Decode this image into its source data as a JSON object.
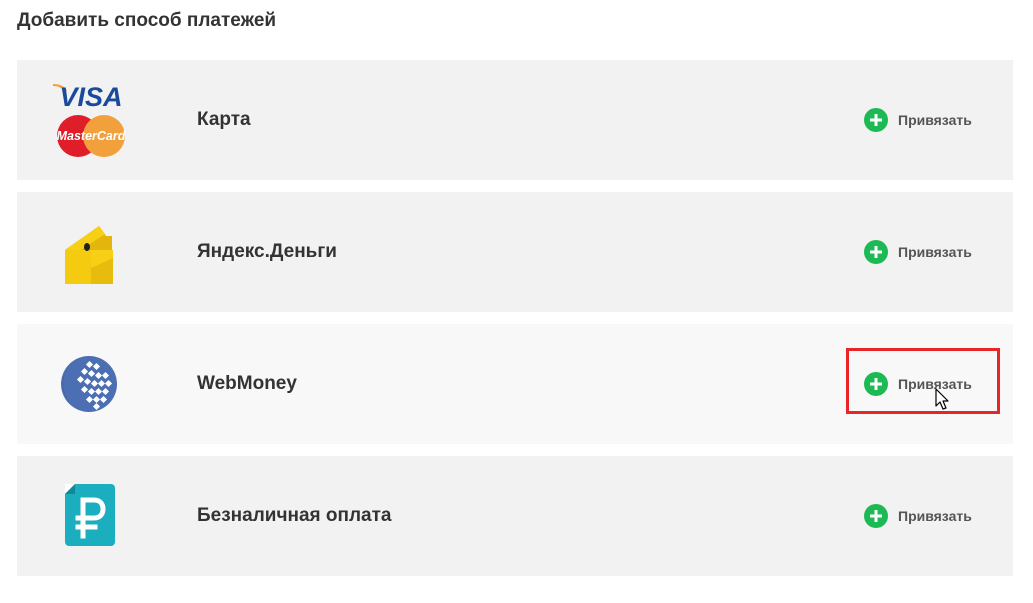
{
  "page": {
    "title": "Добавить способ платежей"
  },
  "methods": [
    {
      "name": "Карта",
      "action": "Привязать",
      "logo_icons": [
        "visa-icon",
        "mastercard-icon"
      ],
      "logo_text": {
        "visa": "VISA",
        "mastercard": "MasterCard"
      }
    },
    {
      "name": "Яндекс.Деньги",
      "action": "Привязать",
      "logo_icons": [
        "yandex-money-wallet-icon"
      ]
    },
    {
      "name": "WebMoney",
      "action": "Привязать",
      "logo_icons": [
        "webmoney-globe-icon"
      ]
    },
    {
      "name": "Безналичная оплата",
      "action": "Привязать",
      "logo_icons": [
        "ruble-document-icon"
      ]
    }
  ],
  "colors": {
    "row_bg": "#f2f2f2",
    "row_hover_bg": "#f8f8f8",
    "plus_green": "#1db954",
    "highlight_red": "#e8262a",
    "visa_blue": "#1a4a9b",
    "mastercard_red": "#e01e2a",
    "mastercard_orange": "#f2a03c",
    "yandex_yellow": "#f7cf15",
    "webmoney_blue": "#4c6fb3",
    "ruble_teal": "#1aaebf"
  }
}
